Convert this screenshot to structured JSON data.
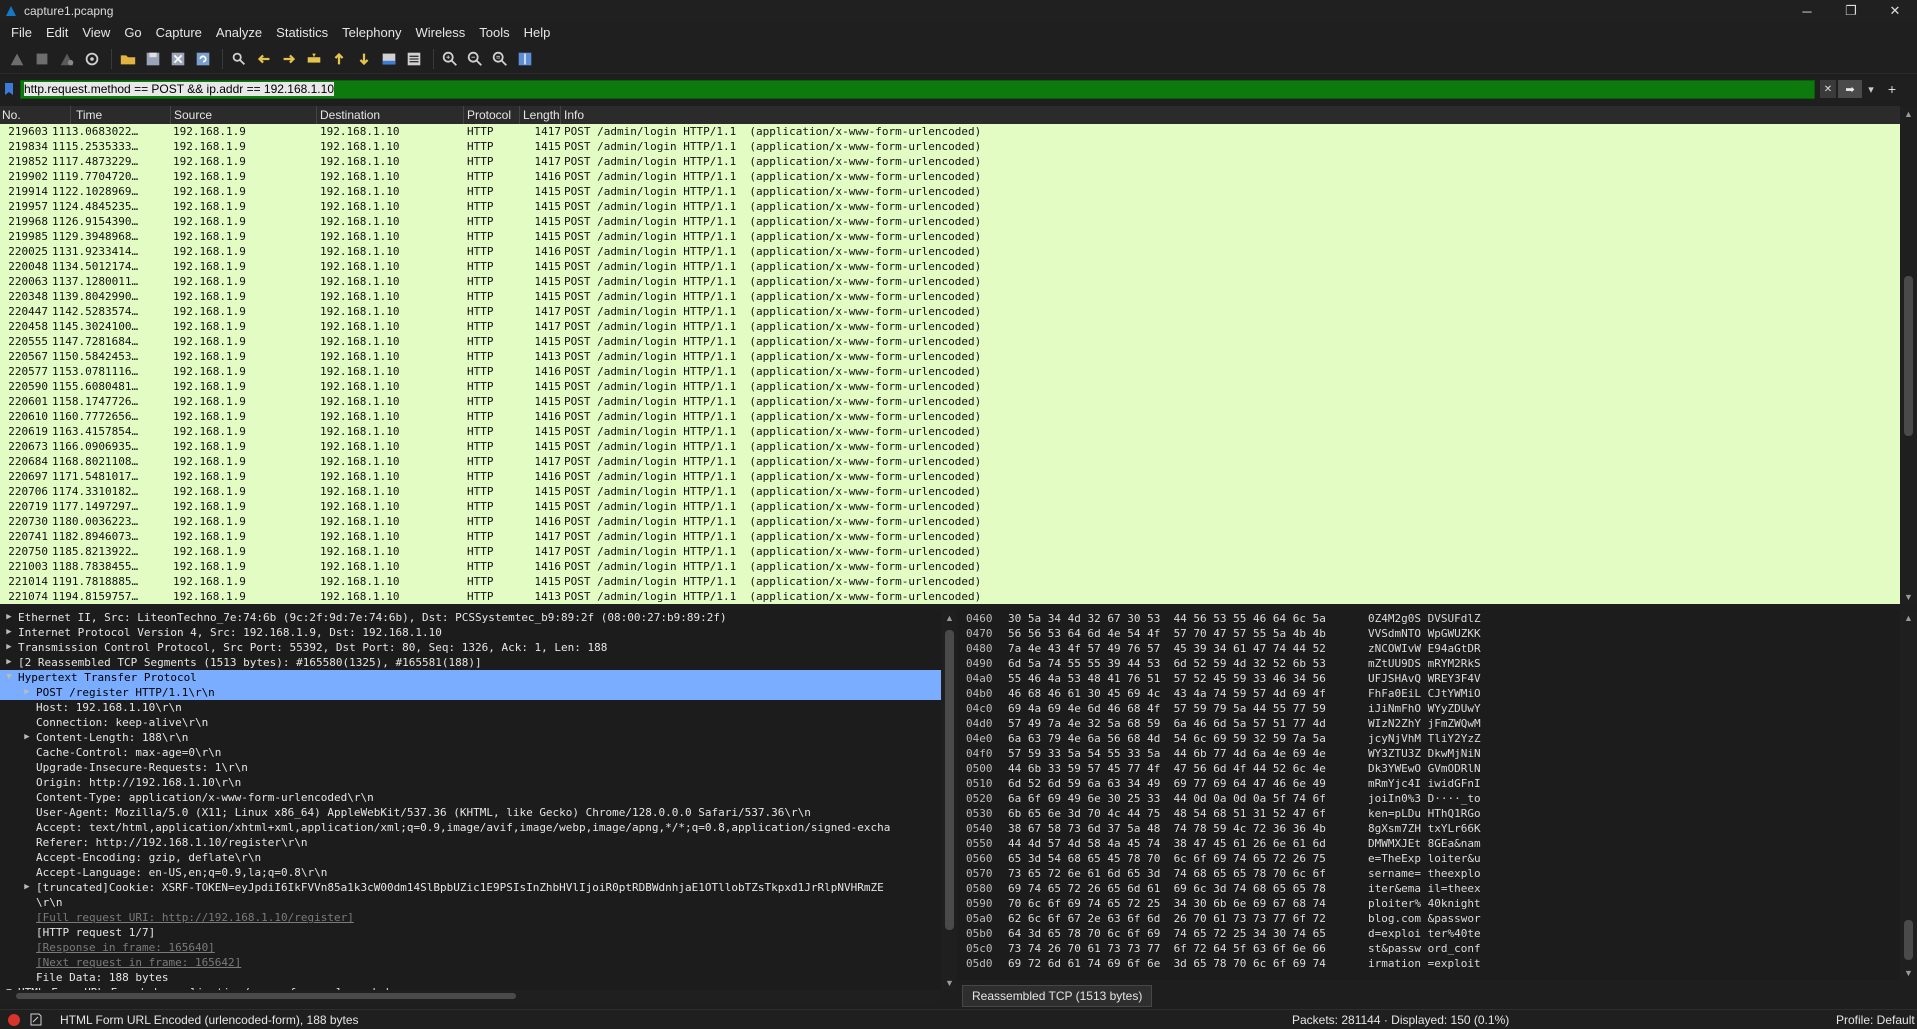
{
  "window": {
    "title": "capture1.pcapng",
    "minimize": "─",
    "maximize": "❐",
    "close": "✕"
  },
  "menu": [
    "File",
    "Edit",
    "View",
    "Go",
    "Capture",
    "Analyze",
    "Statistics",
    "Telephony",
    "Wireless",
    "Tools",
    "Help"
  ],
  "toolbar_icons": [
    "shark-fin-start-icon",
    "stop-square-icon",
    "restart-capture-icon",
    "capture-options-gear-icon",
    "open-folder-icon",
    "save-file-icon",
    "close-file-icon",
    "reload-icon",
    "find-packet-icon",
    "go-back-icon",
    "go-forward-icon",
    "go-to-packet-icon",
    "go-first-icon",
    "go-last-icon",
    "auto-scroll-icon",
    "colorize-icon",
    "zoom-in-icon",
    "zoom-out-icon",
    "zoom-normal-icon",
    "resize-columns-icon"
  ],
  "filter": {
    "value": "http.request.method == POST && ip.addr == 192.168.1.10",
    "clear": "✕",
    "apply": "➡",
    "dropdown": "▾",
    "add": "+"
  },
  "columns": [
    "No.",
    "Time",
    "Source",
    "Destination",
    "Protocol",
    "Length",
    "Info"
  ],
  "packets": [
    {
      "no": "219603",
      "time": "1113.0683022…",
      "src": "192.168.1.9",
      "dst": "192.168.1.10",
      "proto": "HTTP",
      "len": "1417",
      "info": "POST /admin/login HTTP/1.1  (application/x-www-form-urlencoded)"
    },
    {
      "no": "219834",
      "time": "1115.2535333…",
      "src": "192.168.1.9",
      "dst": "192.168.1.10",
      "proto": "HTTP",
      "len": "1415",
      "info": "POST /admin/login HTTP/1.1  (application/x-www-form-urlencoded)"
    },
    {
      "no": "219852",
      "time": "1117.4873229…",
      "src": "192.168.1.9",
      "dst": "192.168.1.10",
      "proto": "HTTP",
      "len": "1417",
      "info": "POST /admin/login HTTP/1.1  (application/x-www-form-urlencoded)"
    },
    {
      "no": "219902",
      "time": "1119.7704720…",
      "src": "192.168.1.9",
      "dst": "192.168.1.10",
      "proto": "HTTP",
      "len": "1416",
      "info": "POST /admin/login HTTP/1.1  (application/x-www-form-urlencoded)"
    },
    {
      "no": "219914",
      "time": "1122.1028969…",
      "src": "192.168.1.9",
      "dst": "192.168.1.10",
      "proto": "HTTP",
      "len": "1415",
      "info": "POST /admin/login HTTP/1.1  (application/x-www-form-urlencoded)"
    },
    {
      "no": "219957",
      "time": "1124.4845235…",
      "src": "192.168.1.9",
      "dst": "192.168.1.10",
      "proto": "HTTP",
      "len": "1415",
      "info": "POST /admin/login HTTP/1.1  (application/x-www-form-urlencoded)"
    },
    {
      "no": "219968",
      "time": "1126.9154390…",
      "src": "192.168.1.9",
      "dst": "192.168.1.10",
      "proto": "HTTP",
      "len": "1415",
      "info": "POST /admin/login HTTP/1.1  (application/x-www-form-urlencoded)"
    },
    {
      "no": "219985",
      "time": "1129.3948968…",
      "src": "192.168.1.9",
      "dst": "192.168.1.10",
      "proto": "HTTP",
      "len": "1415",
      "info": "POST /admin/login HTTP/1.1  (application/x-www-form-urlencoded)"
    },
    {
      "no": "220025",
      "time": "1131.9233414…",
      "src": "192.168.1.9",
      "dst": "192.168.1.10",
      "proto": "HTTP",
      "len": "1416",
      "info": "POST /admin/login HTTP/1.1  (application/x-www-form-urlencoded)"
    },
    {
      "no": "220048",
      "time": "1134.5012174…",
      "src": "192.168.1.9",
      "dst": "192.168.1.10",
      "proto": "HTTP",
      "len": "1415",
      "info": "POST /admin/login HTTP/1.1  (application/x-www-form-urlencoded)"
    },
    {
      "no": "220063",
      "time": "1137.1280011…",
      "src": "192.168.1.9",
      "dst": "192.168.1.10",
      "proto": "HTTP",
      "len": "1415",
      "info": "POST /admin/login HTTP/1.1  (application/x-www-form-urlencoded)"
    },
    {
      "no": "220348",
      "time": "1139.8042990…",
      "src": "192.168.1.9",
      "dst": "192.168.1.10",
      "proto": "HTTP",
      "len": "1415",
      "info": "POST /admin/login HTTP/1.1  (application/x-www-form-urlencoded)"
    },
    {
      "no": "220447",
      "time": "1142.5283574…",
      "src": "192.168.1.9",
      "dst": "192.168.1.10",
      "proto": "HTTP",
      "len": "1417",
      "info": "POST /admin/login HTTP/1.1  (application/x-www-form-urlencoded)"
    },
    {
      "no": "220458",
      "time": "1145.3024100…",
      "src": "192.168.1.9",
      "dst": "192.168.1.10",
      "proto": "HTTP",
      "len": "1417",
      "info": "POST /admin/login HTTP/1.1  (application/x-www-form-urlencoded)"
    },
    {
      "no": "220555",
      "time": "1147.7281684…",
      "src": "192.168.1.9",
      "dst": "192.168.1.10",
      "proto": "HTTP",
      "len": "1415",
      "info": "POST /admin/login HTTP/1.1  (application/x-www-form-urlencoded)"
    },
    {
      "no": "220567",
      "time": "1150.5842453…",
      "src": "192.168.1.9",
      "dst": "192.168.1.10",
      "proto": "HTTP",
      "len": "1413",
      "info": "POST /admin/login HTTP/1.1  (application/x-www-form-urlencoded)"
    },
    {
      "no": "220577",
      "time": "1153.0781116…",
      "src": "192.168.1.9",
      "dst": "192.168.1.10",
      "proto": "HTTP",
      "len": "1416",
      "info": "POST /admin/login HTTP/1.1  (application/x-www-form-urlencoded)"
    },
    {
      "no": "220590",
      "time": "1155.6080481…",
      "src": "192.168.1.9",
      "dst": "192.168.1.10",
      "proto": "HTTP",
      "len": "1415",
      "info": "POST /admin/login HTTP/1.1  (application/x-www-form-urlencoded)"
    },
    {
      "no": "220601",
      "time": "1158.1747726…",
      "src": "192.168.1.9",
      "dst": "192.168.1.10",
      "proto": "HTTP",
      "len": "1415",
      "info": "POST /admin/login HTTP/1.1  (application/x-www-form-urlencoded)"
    },
    {
      "no": "220610",
      "time": "1160.7772656…",
      "src": "192.168.1.9",
      "dst": "192.168.1.10",
      "proto": "HTTP",
      "len": "1416",
      "info": "POST /admin/login HTTP/1.1  (application/x-www-form-urlencoded)"
    },
    {
      "no": "220619",
      "time": "1163.4157854…",
      "src": "192.168.1.9",
      "dst": "192.168.1.10",
      "proto": "HTTP",
      "len": "1415",
      "info": "POST /admin/login HTTP/1.1  (application/x-www-form-urlencoded)"
    },
    {
      "no": "220673",
      "time": "1166.0906935…",
      "src": "192.168.1.9",
      "dst": "192.168.1.10",
      "proto": "HTTP",
      "len": "1415",
      "info": "POST /admin/login HTTP/1.1  (application/x-www-form-urlencoded)"
    },
    {
      "no": "220684",
      "time": "1168.8021108…",
      "src": "192.168.1.9",
      "dst": "192.168.1.10",
      "proto": "HTTP",
      "len": "1417",
      "info": "POST /admin/login HTTP/1.1  (application/x-www-form-urlencoded)"
    },
    {
      "no": "220697",
      "time": "1171.5481017…",
      "src": "192.168.1.9",
      "dst": "192.168.1.10",
      "proto": "HTTP",
      "len": "1416",
      "info": "POST /admin/login HTTP/1.1  (application/x-www-form-urlencoded)"
    },
    {
      "no": "220706",
      "time": "1174.3310182…",
      "src": "192.168.1.9",
      "dst": "192.168.1.10",
      "proto": "HTTP",
      "len": "1415",
      "info": "POST /admin/login HTTP/1.1  (application/x-www-form-urlencoded)"
    },
    {
      "no": "220719",
      "time": "1177.1497297…",
      "src": "192.168.1.9",
      "dst": "192.168.1.10",
      "proto": "HTTP",
      "len": "1415",
      "info": "POST /admin/login HTTP/1.1  (application/x-www-form-urlencoded)"
    },
    {
      "no": "220730",
      "time": "1180.0036223…",
      "src": "192.168.1.9",
      "dst": "192.168.1.10",
      "proto": "HTTP",
      "len": "1416",
      "info": "POST /admin/login HTTP/1.1  (application/x-www-form-urlencoded)"
    },
    {
      "no": "220741",
      "time": "1182.8946073…",
      "src": "192.168.1.9",
      "dst": "192.168.1.10",
      "proto": "HTTP",
      "len": "1417",
      "info": "POST /admin/login HTTP/1.1  (application/x-www-form-urlencoded)"
    },
    {
      "no": "220750",
      "time": "1185.8213922…",
      "src": "192.168.1.9",
      "dst": "192.168.1.10",
      "proto": "HTTP",
      "len": "1417",
      "info": "POST /admin/login HTTP/1.1  (application/x-www-form-urlencoded)"
    },
    {
      "no": "221003",
      "time": "1188.7838455…",
      "src": "192.168.1.9",
      "dst": "192.168.1.10",
      "proto": "HTTP",
      "len": "1416",
      "info": "POST /admin/login HTTP/1.1  (application/x-www-form-urlencoded)"
    },
    {
      "no": "221014",
      "time": "1191.7818885…",
      "src": "192.168.1.9",
      "dst": "192.168.1.10",
      "proto": "HTTP",
      "len": "1415",
      "info": "POST /admin/login HTTP/1.1  (application/x-www-form-urlencoded)"
    },
    {
      "no": "221074",
      "time": "1194.8159757…",
      "src": "192.168.1.9",
      "dst": "192.168.1.10",
      "proto": "HTTP",
      "len": "1413",
      "info": "POST /admin/login HTTP/1.1  (application/x-www-form-urlencoded)"
    }
  ],
  "details": [
    {
      "indent": 0,
      "arrow": "▶",
      "text": "Ethernet II, Src: LiteonTechno_7e:74:6b (9c:2f:9d:7e:74:6b), Dst: PCSSystemtec_b9:89:2f (08:00:27:b9:89:2f)"
    },
    {
      "indent": 0,
      "arrow": "▶",
      "text": "Internet Protocol Version 4, Src: 192.168.1.9, Dst: 192.168.1.10"
    },
    {
      "indent": 0,
      "arrow": "▶",
      "text": "Transmission Control Protocol, Src Port: 55392, Dst Port: 80, Seq: 1326, Ack: 1, Len: 188"
    },
    {
      "indent": 0,
      "arrow": "▶",
      "text": "[2 Reassembled TCP Segments (1513 bytes): #165580(1325), #165581(188)]"
    },
    {
      "indent": 0,
      "arrow": "▼",
      "text": "Hypertext Transfer Protocol",
      "selected": true
    },
    {
      "indent": 1,
      "arrow": "▶",
      "text": "POST /register HTTP/1.1\\r\\n",
      "selected": true
    },
    {
      "indent": 1,
      "arrow": "",
      "text": "Host: 192.168.1.10\\r\\n"
    },
    {
      "indent": 1,
      "arrow": "",
      "text": "Connection: keep-alive\\r\\n"
    },
    {
      "indent": 1,
      "arrow": "▶",
      "text": "Content-Length: 188\\r\\n"
    },
    {
      "indent": 1,
      "arrow": "",
      "text": "Cache-Control: max-age=0\\r\\n"
    },
    {
      "indent": 1,
      "arrow": "",
      "text": "Upgrade-Insecure-Requests: 1\\r\\n"
    },
    {
      "indent": 1,
      "arrow": "",
      "text": "Origin: http://192.168.1.10\\r\\n"
    },
    {
      "indent": 1,
      "arrow": "",
      "text": "Content-Type: application/x-www-form-urlencoded\\r\\n"
    },
    {
      "indent": 1,
      "arrow": "",
      "text": "User-Agent: Mozilla/5.0 (X11; Linux x86_64) AppleWebKit/537.36 (KHTML, like Gecko) Chrome/128.0.0.0 Safari/537.36\\r\\n"
    },
    {
      "indent": 1,
      "arrow": "",
      "text": "Accept: text/html,application/xhtml+xml,application/xml;q=0.9,image/avif,image/webp,image/apng,*/*;q=0.8,application/signed-excha"
    },
    {
      "indent": 1,
      "arrow": "",
      "text": "Referer: http://192.168.1.10/register\\r\\n"
    },
    {
      "indent": 1,
      "arrow": "",
      "text": "Accept-Encoding: gzip, deflate\\r\\n"
    },
    {
      "indent": 1,
      "arrow": "",
      "text": "Accept-Language: en-US,en;q=0.9,la;q=0.8\\r\\n"
    },
    {
      "indent": 1,
      "arrow": "▶",
      "text": "[truncated]Cookie: XSRF-TOKEN=eyJpdiI6IkFVVn85a1k3cW00dm14SlBpbUZic1E9PSIsInZhbHVlIjoiR0ptRDBWdnhjaE1OTllobTZsTkpxd1JrRlpNVHRmZE"
    },
    {
      "indent": 1,
      "arrow": "",
      "text": "\\r\\n"
    },
    {
      "indent": 1,
      "arrow": "",
      "text": "[Full request URI: http://192.168.1.10/register]",
      "link": true
    },
    {
      "indent": 1,
      "arrow": "",
      "text": "[HTTP request 1/7]"
    },
    {
      "indent": 1,
      "arrow": "",
      "text": "[Response in frame: 165640]",
      "link": true
    },
    {
      "indent": 1,
      "arrow": "",
      "text": "[Next request in frame: 165642]",
      "link": true
    },
    {
      "indent": 1,
      "arrow": "",
      "text": "File Data: 188 bytes"
    },
    {
      "indent": 0,
      "arrow": "▼",
      "text": "HTML Form URL Encoded: application/x-www-form-urlencoded"
    }
  ],
  "bytes": [
    {
      "off": "0460",
      "hex": "30 5a 34 4d 32 67 30 53  44 56 53 55 46 64 6c 5a",
      "asc": "0Z4M2g0S DVSUFdlZ"
    },
    {
      "off": "0470",
      "hex": "56 56 53 64 6d 4e 54 4f  57 70 47 57 55 5a 4b 4b",
      "asc": "VVSdmNTO WpGWUZKK"
    },
    {
      "off": "0480",
      "hex": "7a 4e 43 4f 57 49 76 57  45 39 34 61 47 74 44 52",
      "asc": "zNCOWIvW E94aGtDR"
    },
    {
      "off": "0490",
      "hex": "6d 5a 74 55 55 39 44 53  6d 52 59 4d 32 52 6b 53",
      "asc": "mZtUU9DS mRYM2RkS"
    },
    {
      "off": "04a0",
      "hex": "55 46 4a 53 48 41 76 51  57 52 45 59 33 46 34 56",
      "asc": "UFJSHAvQ WREY3F4V"
    },
    {
      "off": "04b0",
      "hex": "46 68 46 61 30 45 69 4c  43 4a 74 59 57 4d 69 4f",
      "asc": "FhFa0EiL CJtYWMiO"
    },
    {
      "off": "04c0",
      "hex": "69 4a 69 4e 6d 46 68 4f  57 59 79 5a 44 55 77 59",
      "asc": "iJiNmFhO WYyZDUwY"
    },
    {
      "off": "04d0",
      "hex": "57 49 7a 4e 32 5a 68 59  6a 46 6d 5a 57 51 77 4d",
      "asc": "WIzN2ZhY jFmZWQwM"
    },
    {
      "off": "04e0",
      "hex": "6a 63 79 4e 6a 56 68 4d  54 6c 69 59 32 59 7a 5a",
      "asc": "jcyNjVhM TliY2YzZ"
    },
    {
      "off": "04f0",
      "hex": "57 59 33 5a 54 55 33 5a  44 6b 77 4d 6a 4e 69 4e",
      "asc": "WY3ZTU3Z DkwMjNiN"
    },
    {
      "off": "0500",
      "hex": "44 6b 33 59 57 45 77 4f  47 56 6d 4f 44 52 6c 4e",
      "asc": "Dk3YWEwO GVmODRlN"
    },
    {
      "off": "0510",
      "hex": "6d 52 6d 59 6a 63 34 49  69 77 69 64 47 46 6e 49",
      "asc": "mRmYjc4I iwidGFnI"
    },
    {
      "off": "0520",
      "hex": "6a 6f 69 49 6e 30 25 33  44 0d 0a 0d 0a 5f 74 6f",
      "asc": "joiIn0%3 D····_to"
    },
    {
      "off": "0530",
      "hex": "6b 65 6e 3d 70 4c 44 75  48 54 68 51 31 52 47 6f",
      "asc": "ken=pLDu HThQ1RGo"
    },
    {
      "off": "0540",
      "hex": "38 67 58 73 6d 37 5a 48  74 78 59 4c 72 36 36 4b",
      "asc": "8gXsm7ZH txYLr66K"
    },
    {
      "off": "0550",
      "hex": "44 4d 57 4d 58 4a 45 74  38 47 45 61 26 6e 61 6d",
      "asc": "DMWMXJEt 8GEa&nam"
    },
    {
      "off": "0560",
      "hex": "65 3d 54 68 65 45 78 70  6c 6f 69 74 65 72 26 75",
      "asc": "e=TheExp loiter&u"
    },
    {
      "off": "0570",
      "hex": "73 65 72 6e 61 6d 65 3d  74 68 65 65 78 70 6c 6f",
      "asc": "sername= theexplo"
    },
    {
      "off": "0580",
      "hex": "69 74 65 72 26 65 6d 61  69 6c 3d 74 68 65 65 78",
      "asc": "iter&ema il=theex"
    },
    {
      "off": "0590",
      "hex": "70 6c 6f 69 74 65 72 25  34 30 6b 6e 69 67 68 74",
      "asc": "ploiter% 40knight"
    },
    {
      "off": "05a0",
      "hex": "62 6c 6f 67 2e 63 6f 6d  26 70 61 73 73 77 6f 72",
      "asc": "blog.com &passwor"
    },
    {
      "off": "05b0",
      "hex": "64 3d 65 78 70 6c 6f 69  74 65 72 25 34 30 74 65",
      "asc": "d=exploi ter%40te"
    },
    {
      "off": "05c0",
      "hex": "73 74 26 70 61 73 73 77  6f 72 64 5f 63 6f 6e 66",
      "asc": "st&passw ord_conf"
    },
    {
      "off": "05d0",
      "hex": "69 72 6d 61 74 69 6f 6e  3d 65 78 70 6c 6f 69 74",
      "asc": "irmation =exploit"
    }
  ],
  "bytes_tab": "Reassembled TCP (1513 bytes)",
  "status": {
    "field": "HTML Form URL Encoded (urlencoded-form), 188 bytes",
    "packets": "Packets: 281144 · Displayed: 150 (0.1%)",
    "profile": "Profile: Default"
  },
  "colors": {
    "packet_row_bg": "#e2fcc4",
    "filter_ok_bg": "#0c7a0c",
    "selected_detail_bg": "#7aacff"
  }
}
